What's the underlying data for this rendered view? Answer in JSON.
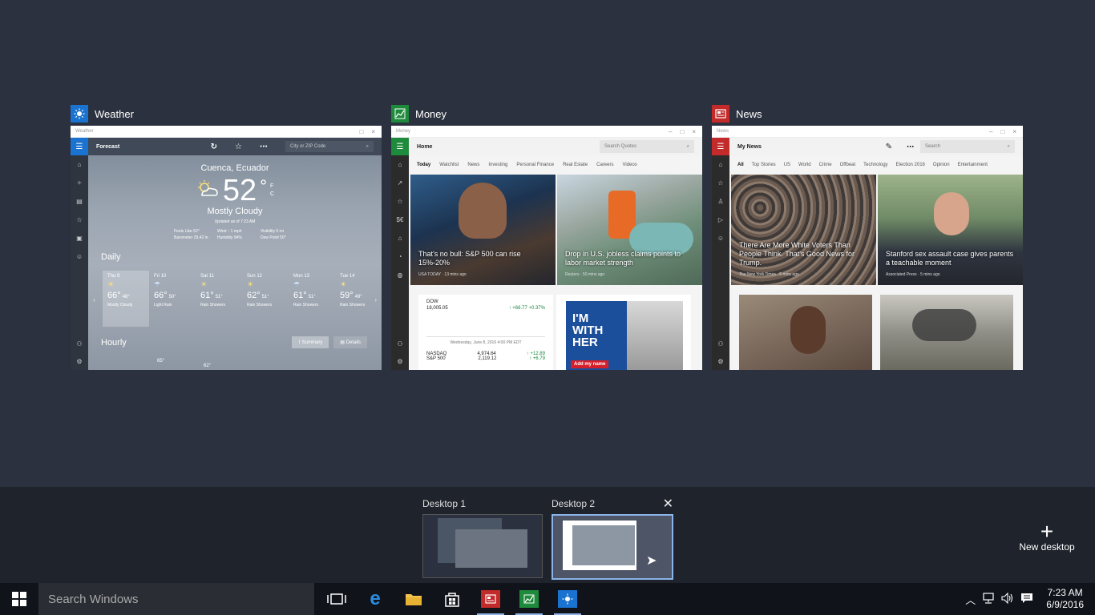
{
  "windows": {
    "weather": {
      "title": "Weather",
      "titlebar": "Weather",
      "command_title": "Forecast",
      "search_placeholder": "City or ZIP Code",
      "location": "Cuenca, Ecuador",
      "temperature": "52",
      "unit_f": "F",
      "unit_c": "C",
      "condition": "Mostly Cloudy",
      "updated": "Updated as of 7:23 AM",
      "details": [
        "Feels Like 52°",
        "Wind ↑ 1 mph",
        "Visibility 5 mi",
        "Barometer 29.42 in",
        "Humidity 94%",
        "Dew Point 50°"
      ],
      "daily_label": "Daily",
      "days": [
        {
          "name": "Thu 9",
          "hi": "66°",
          "lo": "48°",
          "cond": "Mostly Cloudy"
        },
        {
          "name": "Fri 10",
          "hi": "66°",
          "lo": "50°",
          "cond": "Light Rain"
        },
        {
          "name": "Sat 11",
          "hi": "61°",
          "lo": "51°",
          "cond": "Rain Showers"
        },
        {
          "name": "Sun 12",
          "hi": "62°",
          "lo": "51°",
          "cond": "Rain Showers"
        },
        {
          "name": "Mon 13",
          "hi": "61°",
          "lo": "51°",
          "cond": "Rain Showers"
        },
        {
          "name": "Tue 14",
          "hi": "59°",
          "lo": "49°",
          "cond": "Rain Showers"
        }
      ],
      "hourly_label": "Hourly",
      "summary_tab": "Summary",
      "details_tab": "Details",
      "hourly_temps": [
        "65°",
        "62°"
      ]
    },
    "money": {
      "title": "Money",
      "titlebar": "Money",
      "command_title": "Home",
      "search_placeholder": "Search Quotes",
      "nav": [
        "Today",
        "Watchlist",
        "News",
        "Investing",
        "Personal Finance",
        "Real Estate",
        "Careers",
        "Videos"
      ],
      "story1": {
        "caption": "That's no bull: S&P 500 can rise 15%-20%",
        "source": "USA TODAY · 13 mins ago"
      },
      "story2": {
        "caption": "Drop in U.S. jobless claims points to labor market strength",
        "source": "Reuters · 50 mins ago"
      },
      "quotes": {
        "dow_label": "DOW",
        "dow_value": "18,005.05",
        "dow_change": "↑ +66.77 +0.37%",
        "date_line": "Wednesday, June 8, 2016 4:00 PM EDT",
        "nasdaq_label": "NASDAQ",
        "nasdaq_value": "4,974.64",
        "nasdaq_change": "↑ +12.89",
        "sp_label": "S&P 500",
        "sp_value": "2,119.12",
        "sp_change": "↑ +6.79"
      },
      "ad": {
        "line1": "I'M",
        "line2": "WITH",
        "line3": "HER",
        "cta": "Add my name"
      }
    },
    "news": {
      "title": "News",
      "titlebar": "News",
      "command_title": "My News",
      "search_placeholder": "Search",
      "nav": [
        "All",
        "Top Stories",
        "US",
        "World",
        "Crime",
        "Offbeat",
        "Technology",
        "Election 2016",
        "Opinion",
        "Entertainment"
      ],
      "story1": {
        "caption": "There Are More White Voters Than People Think. That's Good News for Trump.",
        "source": "The New York Times · 5 mins ago"
      },
      "story2": {
        "caption": "Stanford sex assault case gives parents a teachable moment",
        "source": "Associated Press · 5 mins ago"
      }
    }
  },
  "desktops": [
    {
      "label": "Desktop 1"
    },
    {
      "label": "Desktop 2"
    }
  ],
  "new_desktop_label": "New desktop",
  "taskbar": {
    "search_placeholder": "Search Windows",
    "time": "7:23 AM",
    "date": "6/9/2016"
  },
  "colors": {
    "background": "#2b313e",
    "weather_icon": "#1a73d1",
    "money_icon": "#1e8a3c",
    "news_icon": "#c32a2a",
    "taskbar": "#10131a",
    "active_desktop_border": "#8bb4ea"
  }
}
